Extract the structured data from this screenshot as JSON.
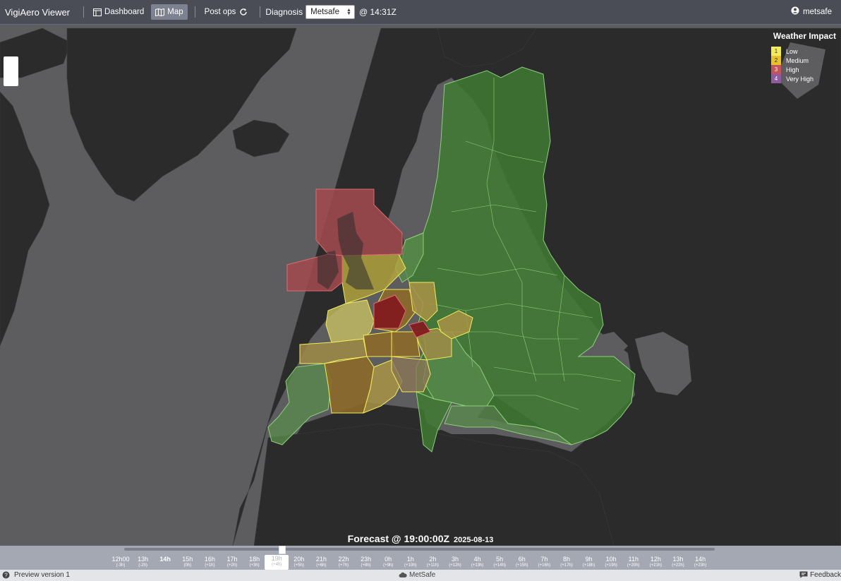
{
  "app": {
    "title": "VigiAero Viewer",
    "nav": [
      {
        "label": "Dashboard",
        "active": false
      },
      {
        "label": "Map",
        "active": true
      }
    ],
    "post_ops_label": "Post ops",
    "diagnosis_label": "Diagnosis",
    "diagnosis_value": "Metsafe",
    "time_label": "@ 14:31Z",
    "user": "metsafe"
  },
  "legend": {
    "title": "Weather Impact",
    "items": [
      {
        "num": "1",
        "label": "Low",
        "color": "#f2ec5c"
      },
      {
        "num": "2",
        "label": "Medium",
        "color": "#e6c32f"
      },
      {
        "num": "3",
        "label": "High",
        "color": "#c4545a"
      },
      {
        "num": "4",
        "label": "Very High",
        "color": "#8e5aa0"
      }
    ]
  },
  "forecast": {
    "label": "Forecast @ 19:00:00Z",
    "date": "2025-08-13"
  },
  "timeline": {
    "ticks": [
      {
        "h": "12h00",
        "o": "(-3h)"
      },
      {
        "h": "13h",
        "o": "(-2h)"
      },
      {
        "h": "14h",
        "o": ""
      },
      {
        "h": "15h",
        "o": "(0h)"
      },
      {
        "h": "16h",
        "o": "(+1h)"
      },
      {
        "h": "17h",
        "o": "(+2h)"
      },
      {
        "h": "18h",
        "o": "(+3h)"
      },
      {
        "h": "19h",
        "o": "(+4h)"
      },
      {
        "h": "20h",
        "o": "(+5h)"
      },
      {
        "h": "21h",
        "o": "(+6h)"
      },
      {
        "h": "22h",
        "o": "(+7h)"
      },
      {
        "h": "23h",
        "o": "(+8h)"
      },
      {
        "h": "0h",
        "o": "(+9h)"
      },
      {
        "h": "1h",
        "o": "(+10h)"
      },
      {
        "h": "2h",
        "o": "(+11h)"
      },
      {
        "h": "3h",
        "o": "(+12h)"
      },
      {
        "h": "4h",
        "o": "(+13h)"
      },
      {
        "h": "5h",
        "o": "(+14h)"
      },
      {
        "h": "6h",
        "o": "(+15h)"
      },
      {
        "h": "7h",
        "o": "(+16h)"
      },
      {
        "h": "8h",
        "o": "(+17h)"
      },
      {
        "h": "9h",
        "o": "(+18h)"
      },
      {
        "h": "10h",
        "o": "(+19h)"
      },
      {
        "h": "11h",
        "o": "(+20h)"
      },
      {
        "h": "12h",
        "o": "(+21h)"
      },
      {
        "h": "13h",
        "o": "(+22h)"
      },
      {
        "h": "14h",
        "o": "(+23h)"
      }
    ],
    "selected_index": 7,
    "current_index": 2
  },
  "footer": {
    "version": "Preview version 1",
    "brand": "MetSafe",
    "feedback": "Feedback"
  }
}
